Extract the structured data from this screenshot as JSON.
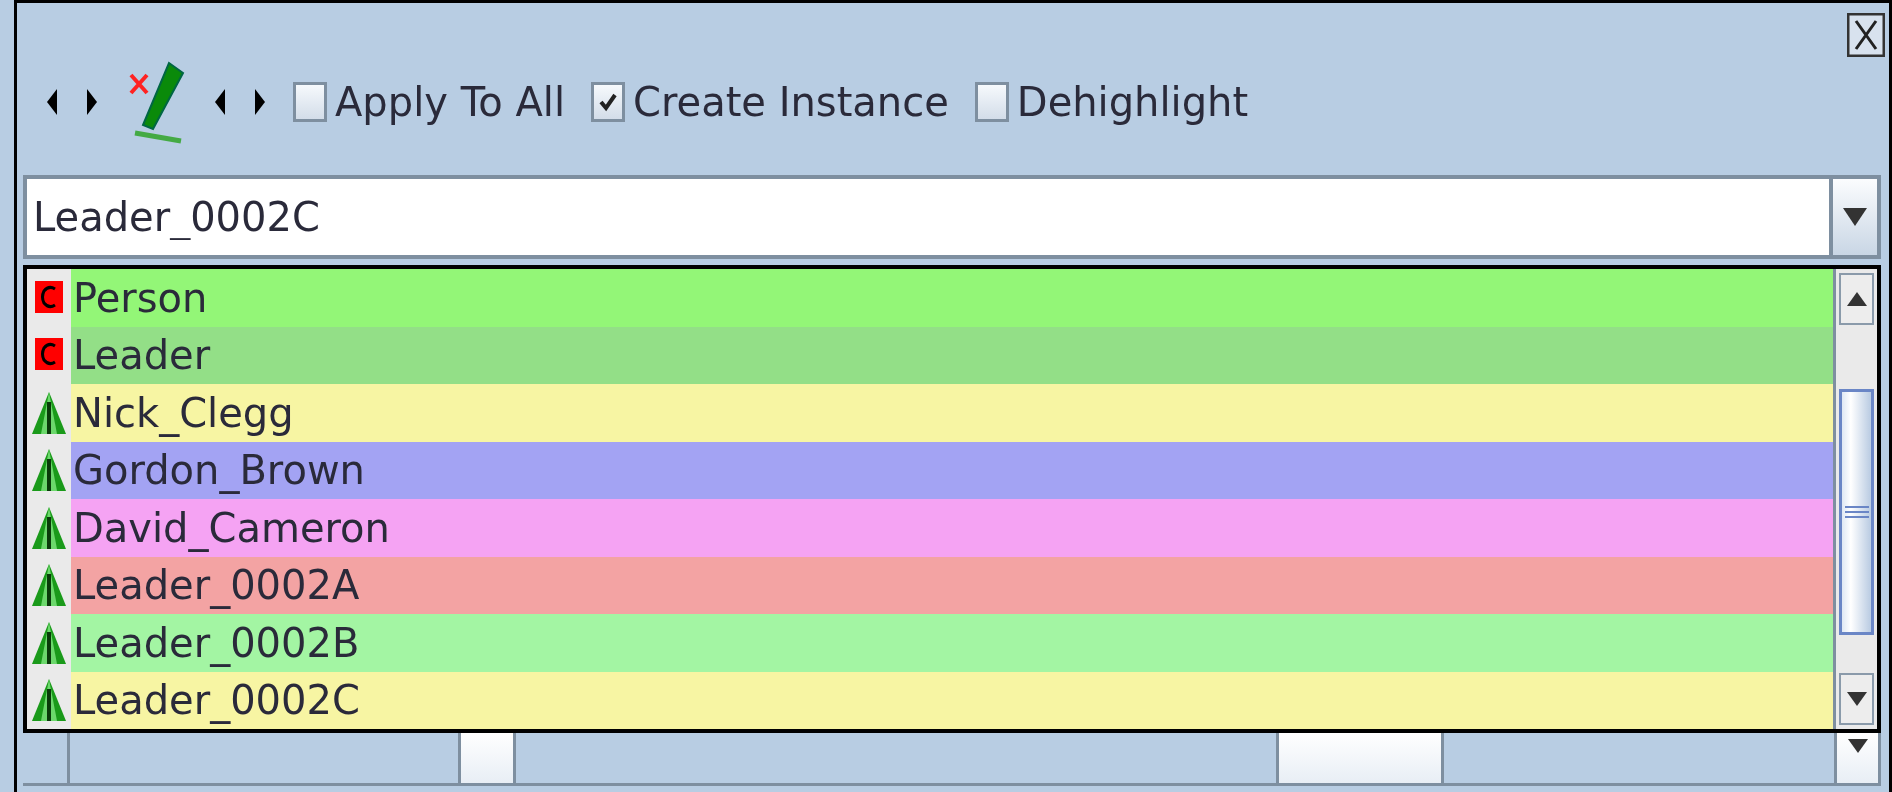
{
  "toolbar": {
    "apply_to_all": {
      "label": "Apply To All",
      "checked": false
    },
    "create_instance": {
      "label": "Create Instance",
      "checked": true
    },
    "dehighlight": {
      "label": "Dehighlight",
      "checked": false
    }
  },
  "combo": {
    "value": "Leader_0002C"
  },
  "list": [
    {
      "label": "Person",
      "kind": "class",
      "color": "#93f677"
    },
    {
      "label": "Leader",
      "kind": "class",
      "color": "#93df87"
    },
    {
      "label": "Nick_Clegg",
      "kind": "instance",
      "color": "#f7f5a3"
    },
    {
      "label": "Gordon_Brown",
      "kind": "instance",
      "color": "#a3a3f3"
    },
    {
      "label": "David_Cameron",
      "kind": "instance",
      "color": "#f5a3f3"
    },
    {
      "label": "Leader_0002A",
      "kind": "instance",
      "color": "#f3a3a3"
    },
    {
      "label": "Leader_0002B",
      "kind": "instance",
      "color": "#a3f5a3"
    },
    {
      "label": "Leader_0002C",
      "kind": "instance",
      "color": "#f7f5a3"
    }
  ]
}
